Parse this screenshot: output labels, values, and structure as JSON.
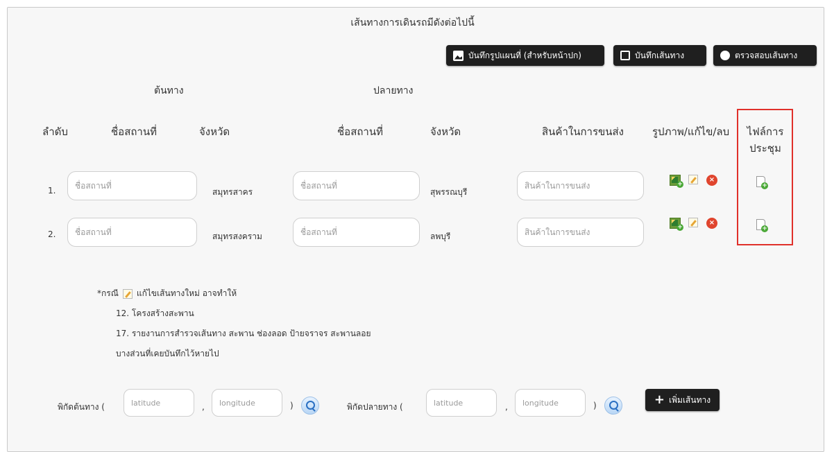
{
  "title": "เส้นทางการเดินรถมีดังต่อไปนี้",
  "toolbar": {
    "save_map_label": "บันทึกรูปแผนที่ (สำหรับหน้าปก)",
    "save_route_label": "บันทึกเส้นทาง",
    "check_route_label": "ตรวจสอบเส้นทาง"
  },
  "groups": {
    "origin": "ต้นทาง",
    "destination": "ปลายทาง"
  },
  "columns": {
    "order": "ลำดับ",
    "origin_place": "ชื่อสถานที่",
    "origin_province": "จังหวัด",
    "dest_place": "ชื่อสถานที่",
    "dest_province": "จังหวัด",
    "goods": "สินค้าในการขนส่ง",
    "actions": "รูปภาพ/แก้ไข/ลบ",
    "meeting_file_line1": "ไฟล์การ",
    "meeting_file_line2": "ประชุม"
  },
  "rows": [
    {
      "order": "1.",
      "origin_place_placeholder": "ชื่อสถานที่",
      "origin_province": "สมุทรสาคร",
      "dest_place_placeholder": "ชื่อสถานที่",
      "dest_province": "สุพรรณบุรี",
      "goods_placeholder": "สินค้าในการขนส่ง"
    },
    {
      "order": "2.",
      "origin_place_placeholder": "ชื่อสถานที่",
      "origin_province": "สมุทรสงคราม",
      "dest_place_placeholder": "ชื่อสถานที่",
      "dest_province": "ลพบุรี",
      "goods_placeholder": "สินค้าในการขนส่ง"
    }
  ],
  "note": {
    "prefix": "*กรณี",
    "suffix": "แก้ไขเส้นทางใหม่ อาจทำให้",
    "line2": "12. โครงสร้างสะพาน",
    "line3": "17. รายงานการสำรวจเส้นทาง สะพาน ช่องลอด ป้ายจราจร สะพานลอย",
    "line4": "บางส่วนที่เคยบันทึกไว้หายไป"
  },
  "coords": {
    "origin_label": "พิกัดต้นทาง (",
    "dest_label": "พิกัดปลายทาง (",
    "lat_placeholder": "latitude",
    "lng_placeholder": "longitude",
    "comma": ",",
    "close_paren": ")"
  },
  "add_route_label": "เพิ่มเส้นทาง",
  "colors": {
    "button_bg": "#1f1f1f",
    "highlight": "#e0302a"
  }
}
